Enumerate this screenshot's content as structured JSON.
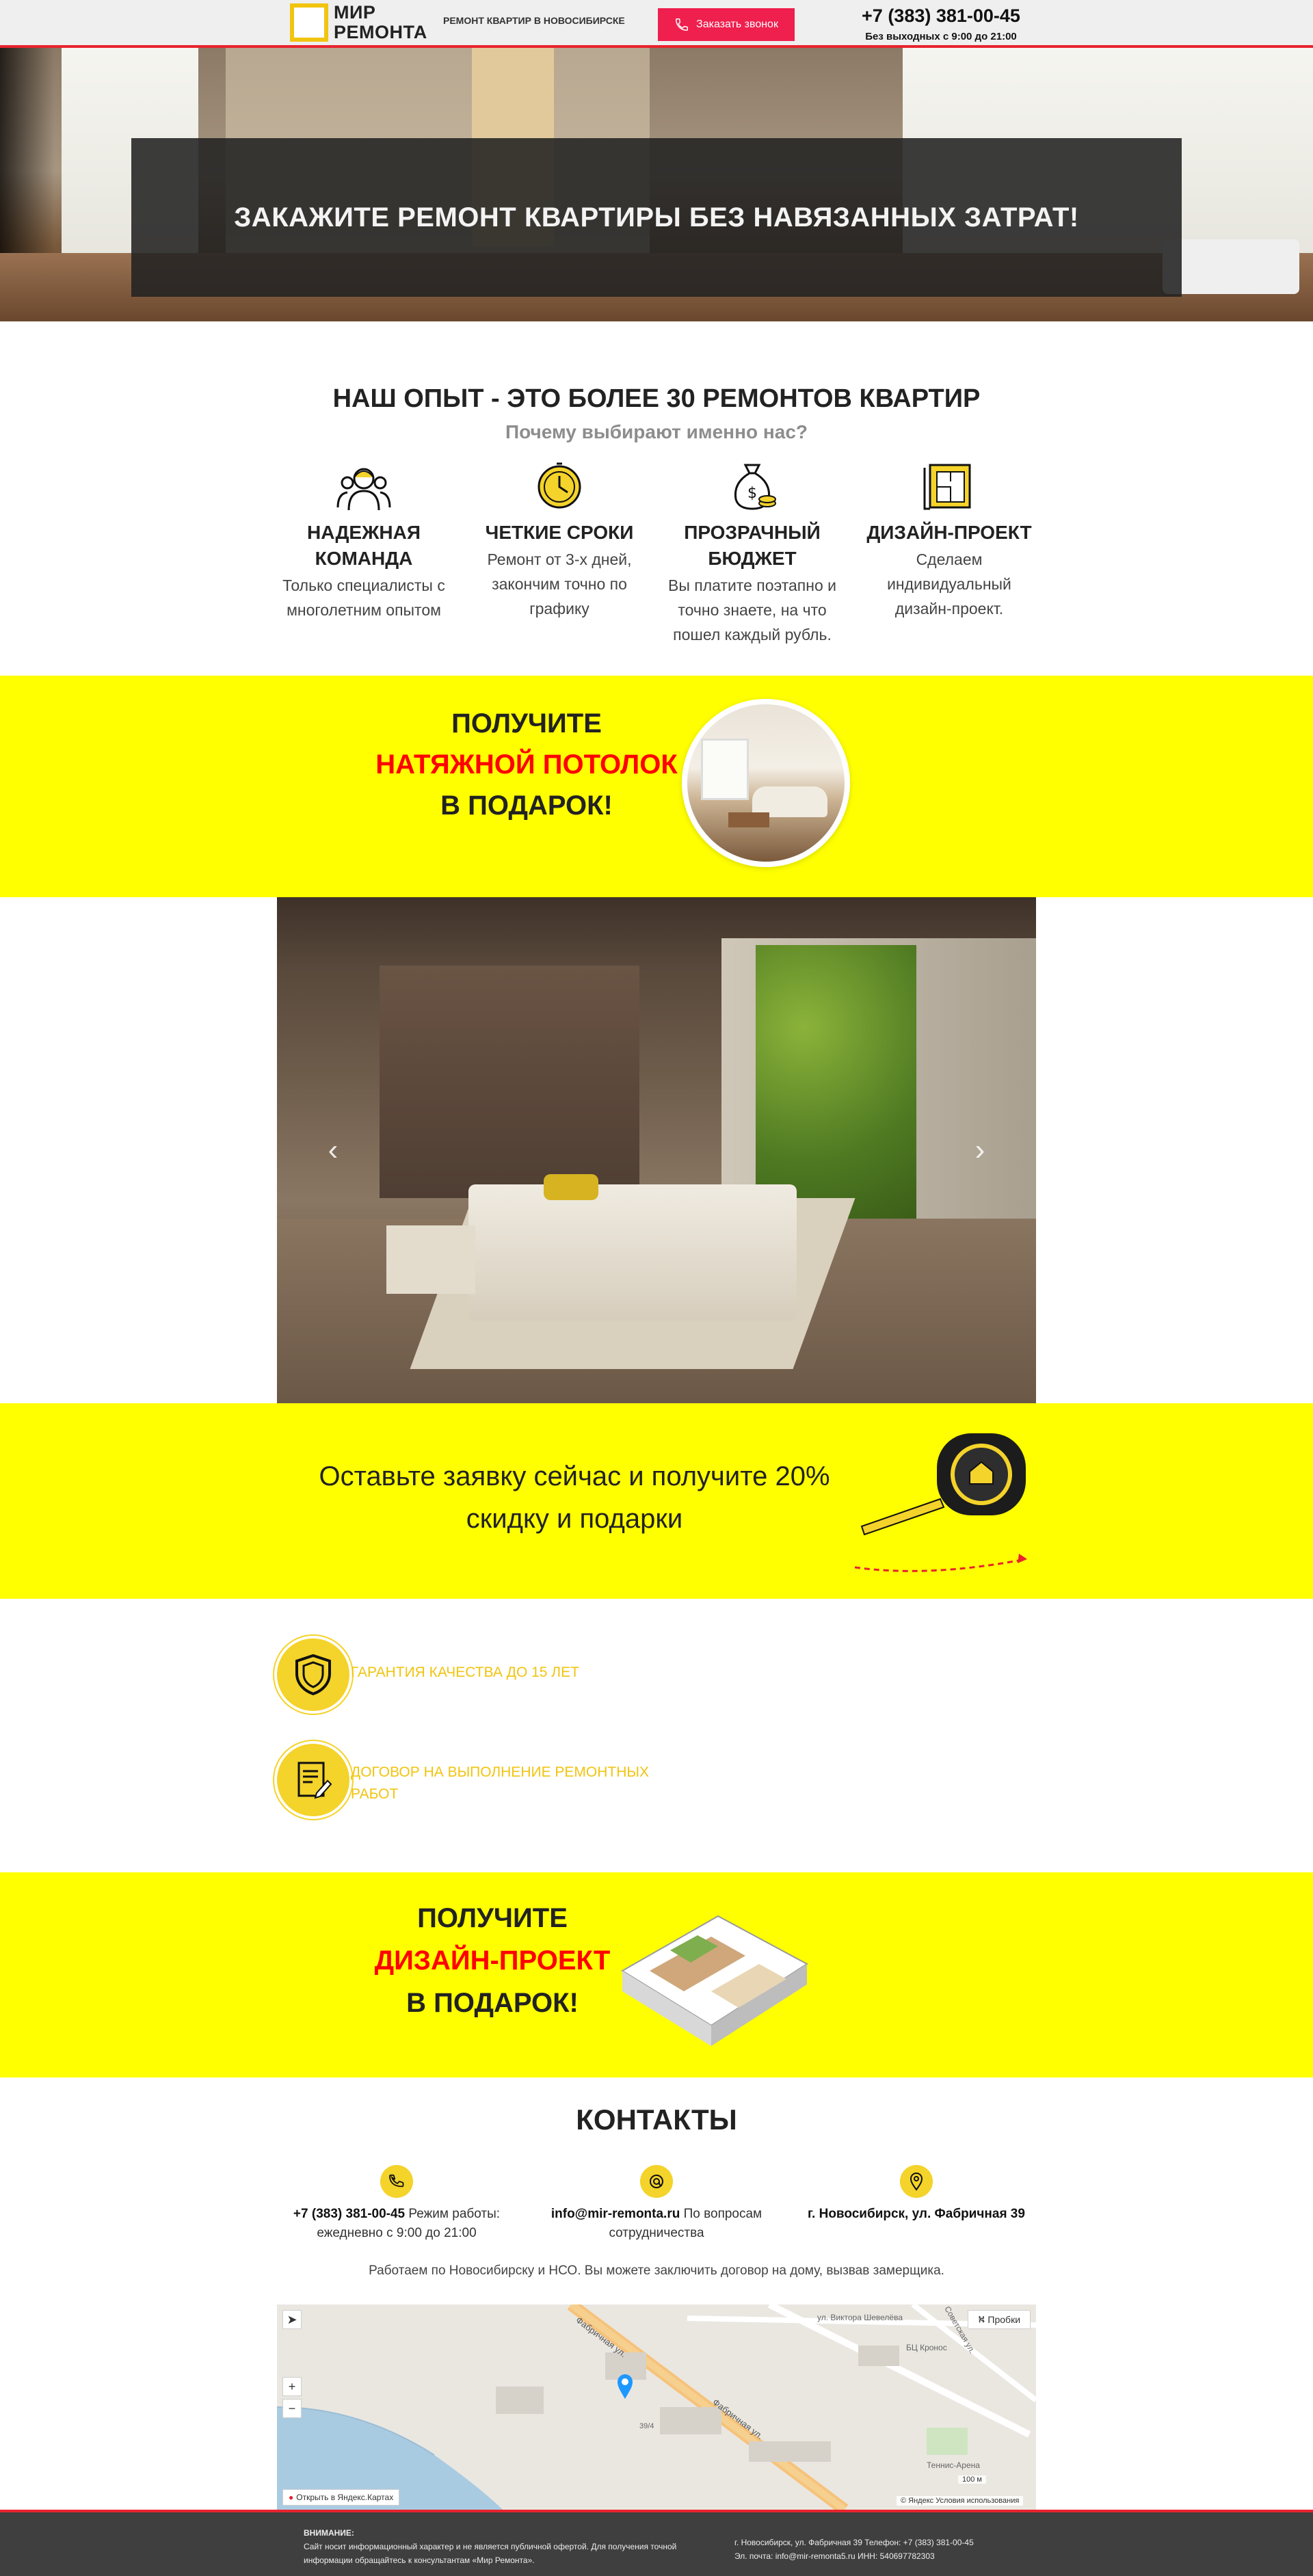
{
  "header": {
    "logo_text": "МИР\nРЕМОНТА",
    "tagline": "РЕМОНТ КВАРТИР В НОВОСИБИРСКЕ",
    "callback_label": "Заказать звонок",
    "phone": "+7 (383) 381-00-45",
    "hours": "Без выходных с 9:00 до 21:00",
    "colors": {
      "accent": "#e8232e",
      "button": "#ef1f4e",
      "logo_frame": "#f1c40f"
    }
  },
  "hero": {
    "title": "ЗАКАЖИТЕ РЕМОНТ КВАРТИРЫ БЕЗ НАВЯЗАННЫХ ЗАТРАТ!"
  },
  "experience": {
    "title": "НАШ ОПЫТ - ЭТО БОЛЕЕ 30 РЕМОНТОВ КВАРТИР",
    "subtitle": "Почему выбирают именно нас?",
    "features": [
      {
        "icon": "team-icon",
        "title": "НАДЕЖНАЯ КОМАНДА",
        "text": "Только специалисты с многолетним опытом"
      },
      {
        "icon": "clock-icon",
        "title": "ЧЕТКИЕ СРОКИ",
        "text": "Ремонт от 3-х дней, закончим точно по графику"
      },
      {
        "icon": "money-bag-icon",
        "title": "ПРОЗРАЧНЫЙ БЮДЖЕТ",
        "text": "Вы платите поэтапно и точно знаете, на что пошел каждый рубль."
      },
      {
        "icon": "blueprint-icon",
        "title": "ДИЗАЙН-ПРОЕКТ",
        "text": "Сделаем индивидуальный дизайн-проект."
      }
    ]
  },
  "promo1": {
    "line1": "ПОЛУЧИТЕ",
    "highlight": "НАТЯЖНОЙ ПОТОЛОК",
    "line3": "В ПОДАРОК!"
  },
  "slider": {
    "prev_label": "‹",
    "next_label": "›"
  },
  "promo2": {
    "text": "Оставьте заявку сейчас и получите 20% скидку и подарки"
  },
  "guarantees": [
    {
      "icon": "shield-icon",
      "text": "ГАРАНТИЯ КАЧЕСТВА ДО 15 ЛЕТ"
    },
    {
      "icon": "contract-icon",
      "text": "ДОГОВОР НА ВЫПОЛНЕНИЕ РЕМОНТНЫХ РАБОТ"
    }
  ],
  "promo3": {
    "line1": "ПОЛУЧИТЕ",
    "highlight": "ДИЗАЙН-ПРОЕКТ",
    "line3": "В ПОДАРОК!"
  },
  "contacts": {
    "title": "КОНТАКТЫ",
    "items": [
      {
        "icon": "phone-icon",
        "bold": "+7 (383) 381-00-45",
        "text": " Режим работы: ежедневно с 9:00 до 21:00"
      },
      {
        "icon": "at-icon",
        "bold": "info@mir-remonta.ru",
        "text": " По вопросам сотрудничества"
      },
      {
        "icon": "location-pin-icon",
        "bold": "г. Новосибирск, ул. Фабричная 39",
        "text": ""
      }
    ],
    "note": "Работаем по Новосибирску и НСО. Вы можете заключить договор на дому, вызвав замерщика."
  },
  "map": {
    "traffic_label": "Пробки",
    "zoom_in": "+",
    "zoom_out": "−",
    "open_label": "Открыть в Яндекс.Картах",
    "scale_label": "100 м",
    "copyright": "© Яндекс Условия использования",
    "street1": "Фабричная ул.",
    "street2": "Фабричная ул.",
    "street3": "ул. Виктора Шевелёва",
    "street4": "Советская ул.",
    "poi1": "БЦ Кронос",
    "poi2": "Теннис-Арена",
    "building": "39/4"
  },
  "footer": {
    "warning_title": "ВНИМАНИЕ:",
    "warning_text": "Сайт носит информационный характер и не является публичной офертой. Для получения точной информации обращайтесь к консультантам «Мир Ремонта».",
    "address": "г. Новосибирск, ул. Фабричная 39 Телефон: +7 (383) 381-00-45",
    "email": "Эл. почта: info@mir-remonta5.ru ИНН: 540697782303"
  }
}
